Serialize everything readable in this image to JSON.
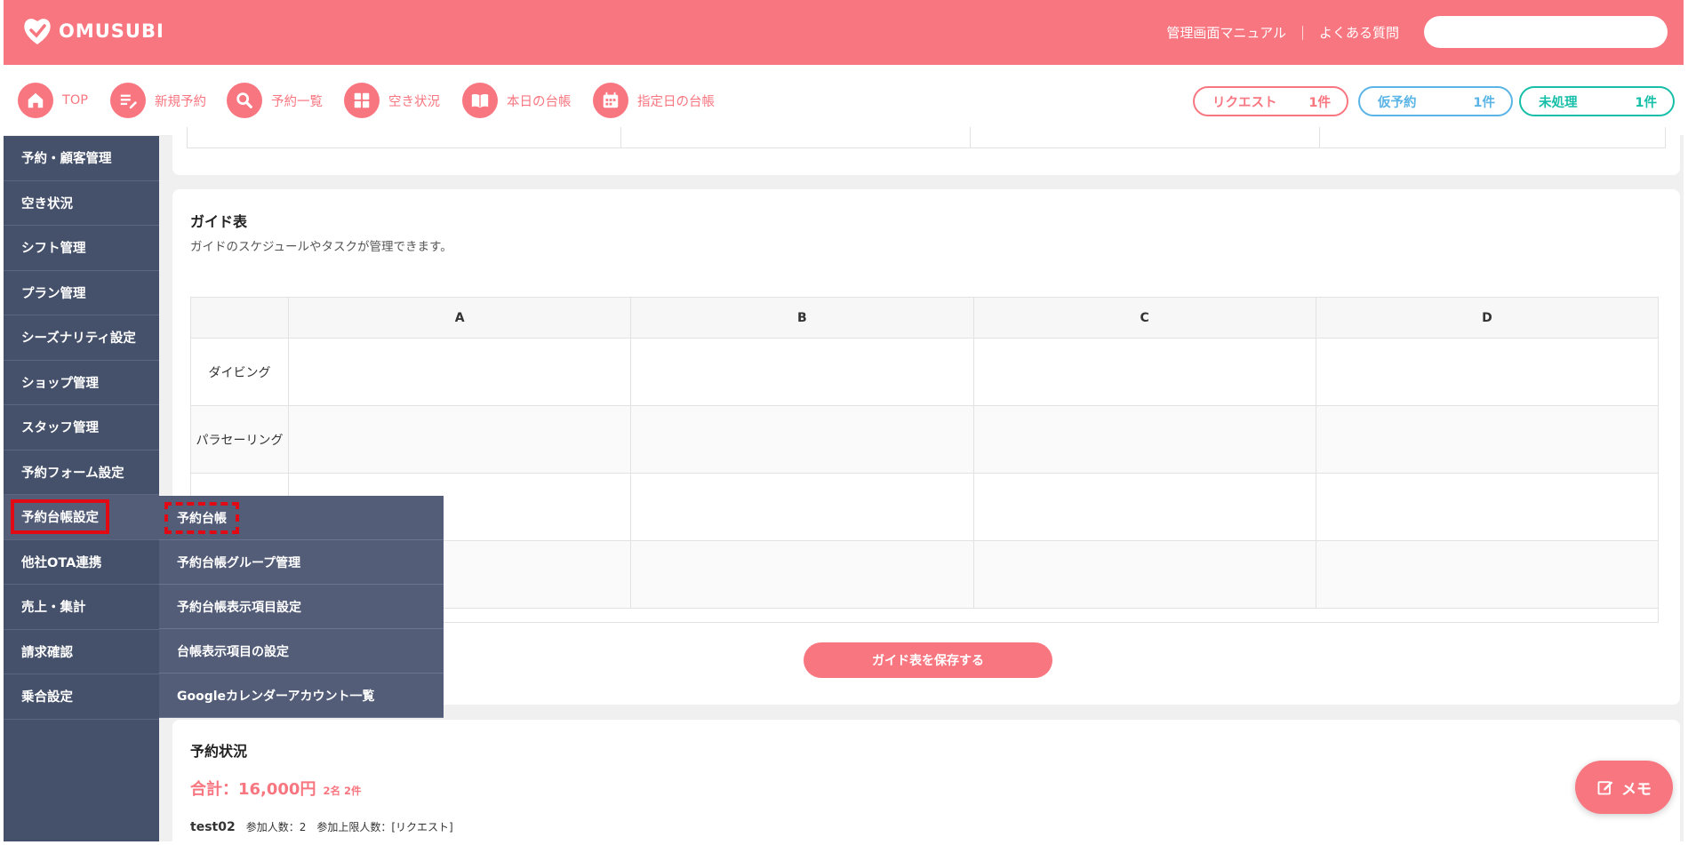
{
  "header": {
    "logo": "OMUSUBI",
    "links": [
      "管理画面マニュアル",
      "よくある質問"
    ],
    "search_placeholder": ""
  },
  "nav": {
    "items": [
      {
        "label": "TOP",
        "icon": "home-icon"
      },
      {
        "label": "新規予約",
        "icon": "edit-list-icon"
      },
      {
        "label": "予約一覧",
        "icon": "search-icon"
      },
      {
        "label": "空き状況",
        "icon": "grid-icon"
      },
      {
        "label": "本日の台帳",
        "icon": "book-icon"
      },
      {
        "label": "指定日の台帳",
        "icon": "calendar-icon"
      }
    ],
    "badges": [
      {
        "label": "リクエスト",
        "count": "1件",
        "color": "#f87680"
      },
      {
        "label": "仮予約",
        "count": "1件",
        "color": "#5ab4e5"
      },
      {
        "label": "未処理",
        "count": "1件",
        "color": "#17bfa8"
      }
    ]
  },
  "sidebar": {
    "items": [
      "予約・顧客管理",
      "空き状況",
      "シフト管理",
      "プラン管理",
      "シーズナリティ設定",
      "ショップ管理",
      "スタッフ管理",
      "予約フォーム設定",
      "予約台帳設定",
      "他社OTA連携",
      "売上・集計",
      "請求確認",
      "乗合設定"
    ],
    "active_index": 8
  },
  "flyout": {
    "items": [
      "予約台帳",
      "予約台帳グループ管理",
      "予約台帳表示項目設定",
      "台帳表示項目の設定",
      "Googleカレンダーアカウント一覧"
    ]
  },
  "guide": {
    "title": "ガイド表",
    "description": "ガイドのスケジュールやタスクが管理できます。",
    "columns": [
      "A",
      "B",
      "C",
      "D"
    ],
    "rows": [
      "ダイビング",
      "パラセーリング",
      "",
      ""
    ],
    "save_label": "ガイド表を保存する"
  },
  "status": {
    "title": "予約状況",
    "total": "合計：16,000円",
    "total_sub": "2名 2件",
    "row_name": "test02",
    "row_count": "参加人数：2",
    "row_limit": "参加上限人数：[リクエスト]"
  },
  "memo_label": "メモ",
  "colors": {
    "brand": "#f87680",
    "sidebar": "#45506a",
    "highlight": "#e10a14"
  }
}
